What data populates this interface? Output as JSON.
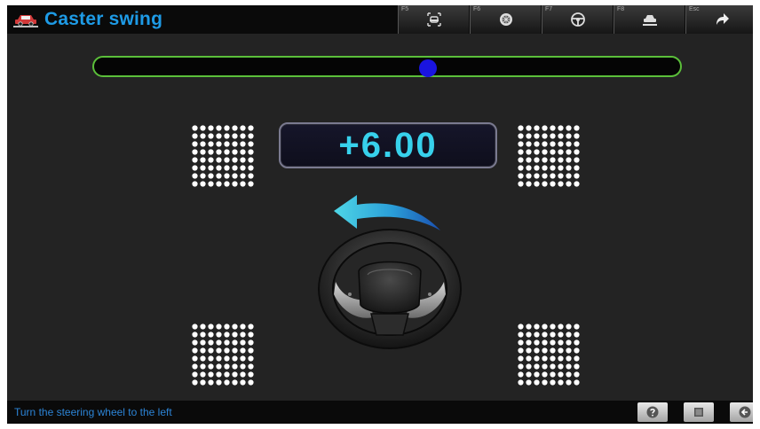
{
  "app": {
    "title": "Caster swing",
    "title_icon": "car-lift-icon"
  },
  "toolbar": {
    "keys": [
      {
        "fkey": "F5",
        "icon": "vehicle-front-icon"
      },
      {
        "fkey": "F6",
        "icon": "wheel-icon"
      },
      {
        "fkey": "F7",
        "icon": "steering-wheel-icon"
      },
      {
        "fkey": "F8",
        "icon": "car-lift-icon"
      },
      {
        "fkey": "Esc",
        "icon": "forward-arrow-icon"
      }
    ]
  },
  "slider": {
    "position_fraction": 0.57,
    "track_color": "#5bbf3a",
    "knob_color": "#1a14e0"
  },
  "readout": {
    "value": "+6.00",
    "color": "#37d1ec"
  },
  "instruction": {
    "direction": "left",
    "arrow_color": "#2ab8d8"
  },
  "status": {
    "message": "Turn the steering wheel to the left"
  },
  "footer_buttons": [
    {
      "icon": "help-icon"
    },
    {
      "icon": "stop-icon"
    },
    {
      "icon": "back-icon"
    }
  ],
  "colors": {
    "title": "#1e9be6",
    "status_text": "#2c84d6",
    "background": "#232323"
  }
}
